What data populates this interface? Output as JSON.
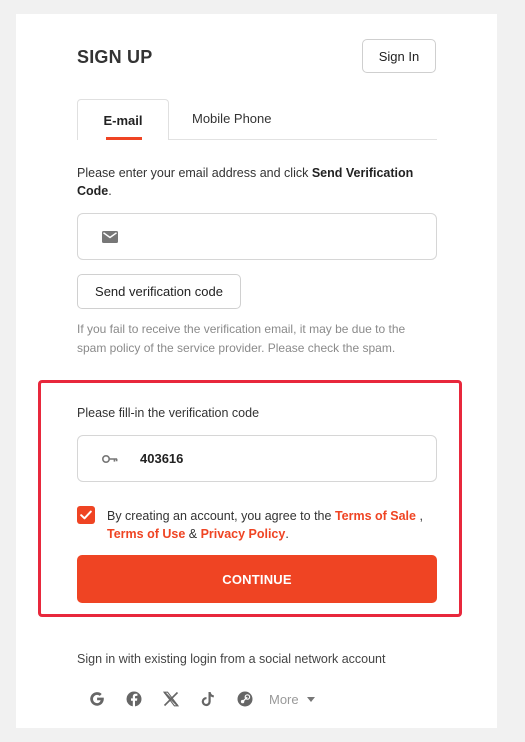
{
  "header": {
    "title": "SIGN UP",
    "signin_label": "Sign In"
  },
  "tabs": [
    {
      "label": "E-mail",
      "active": true
    },
    {
      "label": "Mobile Phone",
      "active": false
    }
  ],
  "email_step": {
    "instruction_prefix": "Please enter your email address and click ",
    "instruction_bold": "Send Verification Code",
    "instruction_suffix": ".",
    "email_value": "",
    "send_button": "Send verification code",
    "hint": "If you fail to receive the verification email, it may be due to the spam policy of the service provider. Please check the spam."
  },
  "verification": {
    "label": "Please fill-in the verification code",
    "code_value": "403616"
  },
  "agreement": {
    "checked": true,
    "prefix": "By creating an account, you agree to the ",
    "terms_of_sale": "Terms of Sale",
    "sep1": " ,",
    "terms_of_use": "Terms of Use",
    "sep2": " & ",
    "privacy_policy": "Privacy Policy",
    "suffix": "."
  },
  "continue_label": "CONTINUE",
  "social": {
    "label": "Sign in with existing login from a social network account",
    "icons": [
      "google-icon",
      "facebook-icon",
      "x-icon",
      "tiktok-icon",
      "steam-icon"
    ],
    "more_label": "More"
  },
  "colors": {
    "accent": "#ef4423",
    "highlight": "#e8283c"
  }
}
